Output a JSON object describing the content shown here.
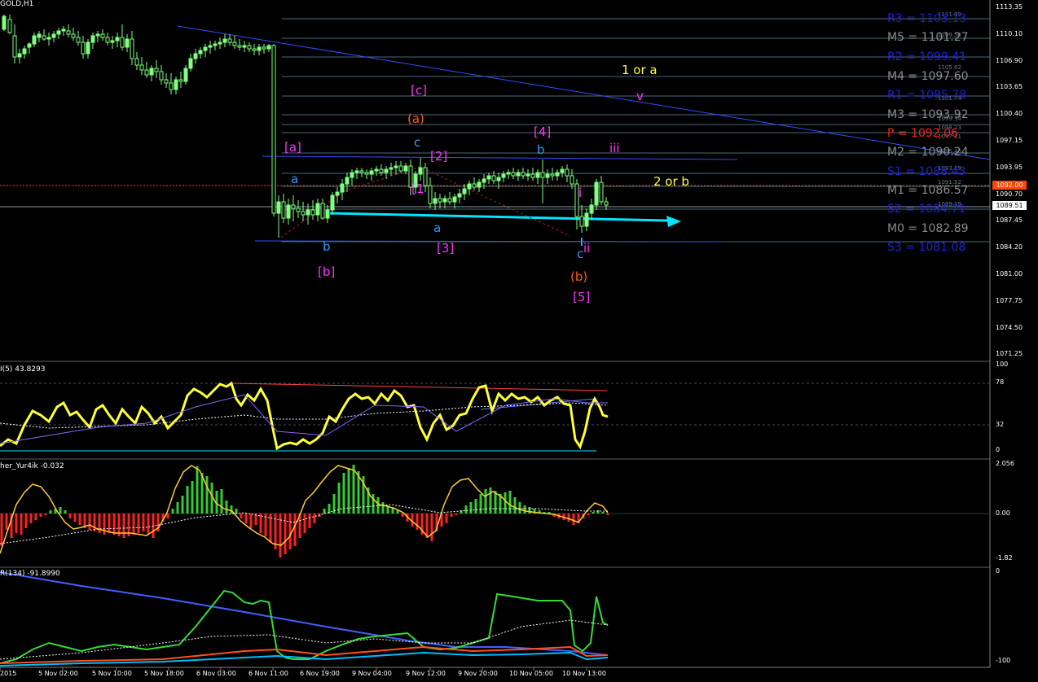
{
  "chart": {
    "symbol": "GOLD,H1",
    "indicators": {
      "rsi": "I(5) 43.8293",
      "fisher": "her_Yur4ik -0.032",
      "wpr": "R(134) -91.8990"
    }
  },
  "price_axis": [
    "1113.35",
    "1110.10",
    "1106.90",
    "1103.65",
    "1100.40",
    "1097.15",
    "1093.95",
    "1090.70",
    "1087.45",
    "1084.20",
    "1081.00",
    "1077.75",
    "1074.50",
    "1071.25"
  ],
  "price_tags": {
    "current_bid": "1092.00",
    "last": "1089.51"
  },
  "rsi_axis": [
    "100",
    "78",
    "32",
    "0"
  ],
  "fisher_axis": [
    "2.056",
    "0.00",
    "-1.82"
  ],
  "wpr_axis": [
    "0",
    "-100"
  ],
  "time_axis": [
    "2015",
    "5 Nov 02:00",
    "5 Nov 10:00",
    "5 Nov 18:00",
    "6 Nov 03:00",
    "6 Nov 11:00",
    "6 Nov 19:00",
    "9 Nov 04:00",
    "9 Nov 12:00",
    "9 Nov 20:00",
    "10 Nov 05:00",
    "10 Nov 13:00"
  ],
  "pivots": [
    {
      "label": "R3 = 1103.13",
      "color": "#1e22d9"
    },
    {
      "label": "M5 = 1101.27",
      "color": "#8c8c8c"
    },
    {
      "label": "R2 = 1099.41",
      "color": "#1e22d9"
    },
    {
      "label": "M4 = 1097.60",
      "color": "#8c8c8c"
    },
    {
      "label": "R1 = 1095.78",
      "color": "#1e22d9"
    },
    {
      "label": "M3 = 1093.92",
      "color": "#8c8c8c"
    },
    {
      "label": "P  = 1092.06",
      "color": "#ff2020"
    },
    {
      "label": "M2 = 1090.24",
      "color": "#8c8c8c"
    },
    {
      "label": "S1 = 1088.43",
      "color": "#1e22d9"
    },
    {
      "label": "M1 = 1086.57",
      "color": "#8c8c8c"
    },
    {
      "label": "S2 = 1084.71",
      "color": "#1e22d9"
    },
    {
      "label": "M0 = 1082.89",
      "color": "#8c8c8c"
    },
    {
      "label": "S3 = 1081.08",
      "color": "#1e22d9"
    }
  ],
  "level_tags": [
    "1111.89",
    "1109.50",
    "1105.62",
    "1101.74",
    "1099.34",
    "1098.23",
    "1097.21",
    "1095.46",
    "1093.29",
    "1091.52",
    "1089.19"
  ],
  "waves": {
    "c_bracket": "[c]",
    "a_paren": "(a)",
    "a_bracket": "[a]",
    "a_blue": "a",
    "b_blue": "b",
    "b_bracket": "[b]",
    "c_blue": "c",
    "two_bracket": "[2]",
    "one_bracket": "[1",
    "a_blue2": "a",
    "three_bracket": "[3]",
    "four_bracket": "[4]",
    "b_blue2": "b",
    "iii": "iii",
    "i_lbl": "i",
    "ii_lbl": "ii",
    "c_blue2": "c",
    "b_paren": "(b)",
    "five_bracket": "[5]",
    "one_or_a": "1 or a",
    "v_lbl": "v",
    "two_or_b": "2 or b"
  },
  "colors": {
    "candles": "#80ff80",
    "rsi": "#ffff33",
    "fisher_pos": "#33cc33",
    "fisher_neg": "#ff2020",
    "trend": "#4060ff",
    "arrow": "#00e5ff",
    "pivot_line": "#4a6a7a"
  }
}
